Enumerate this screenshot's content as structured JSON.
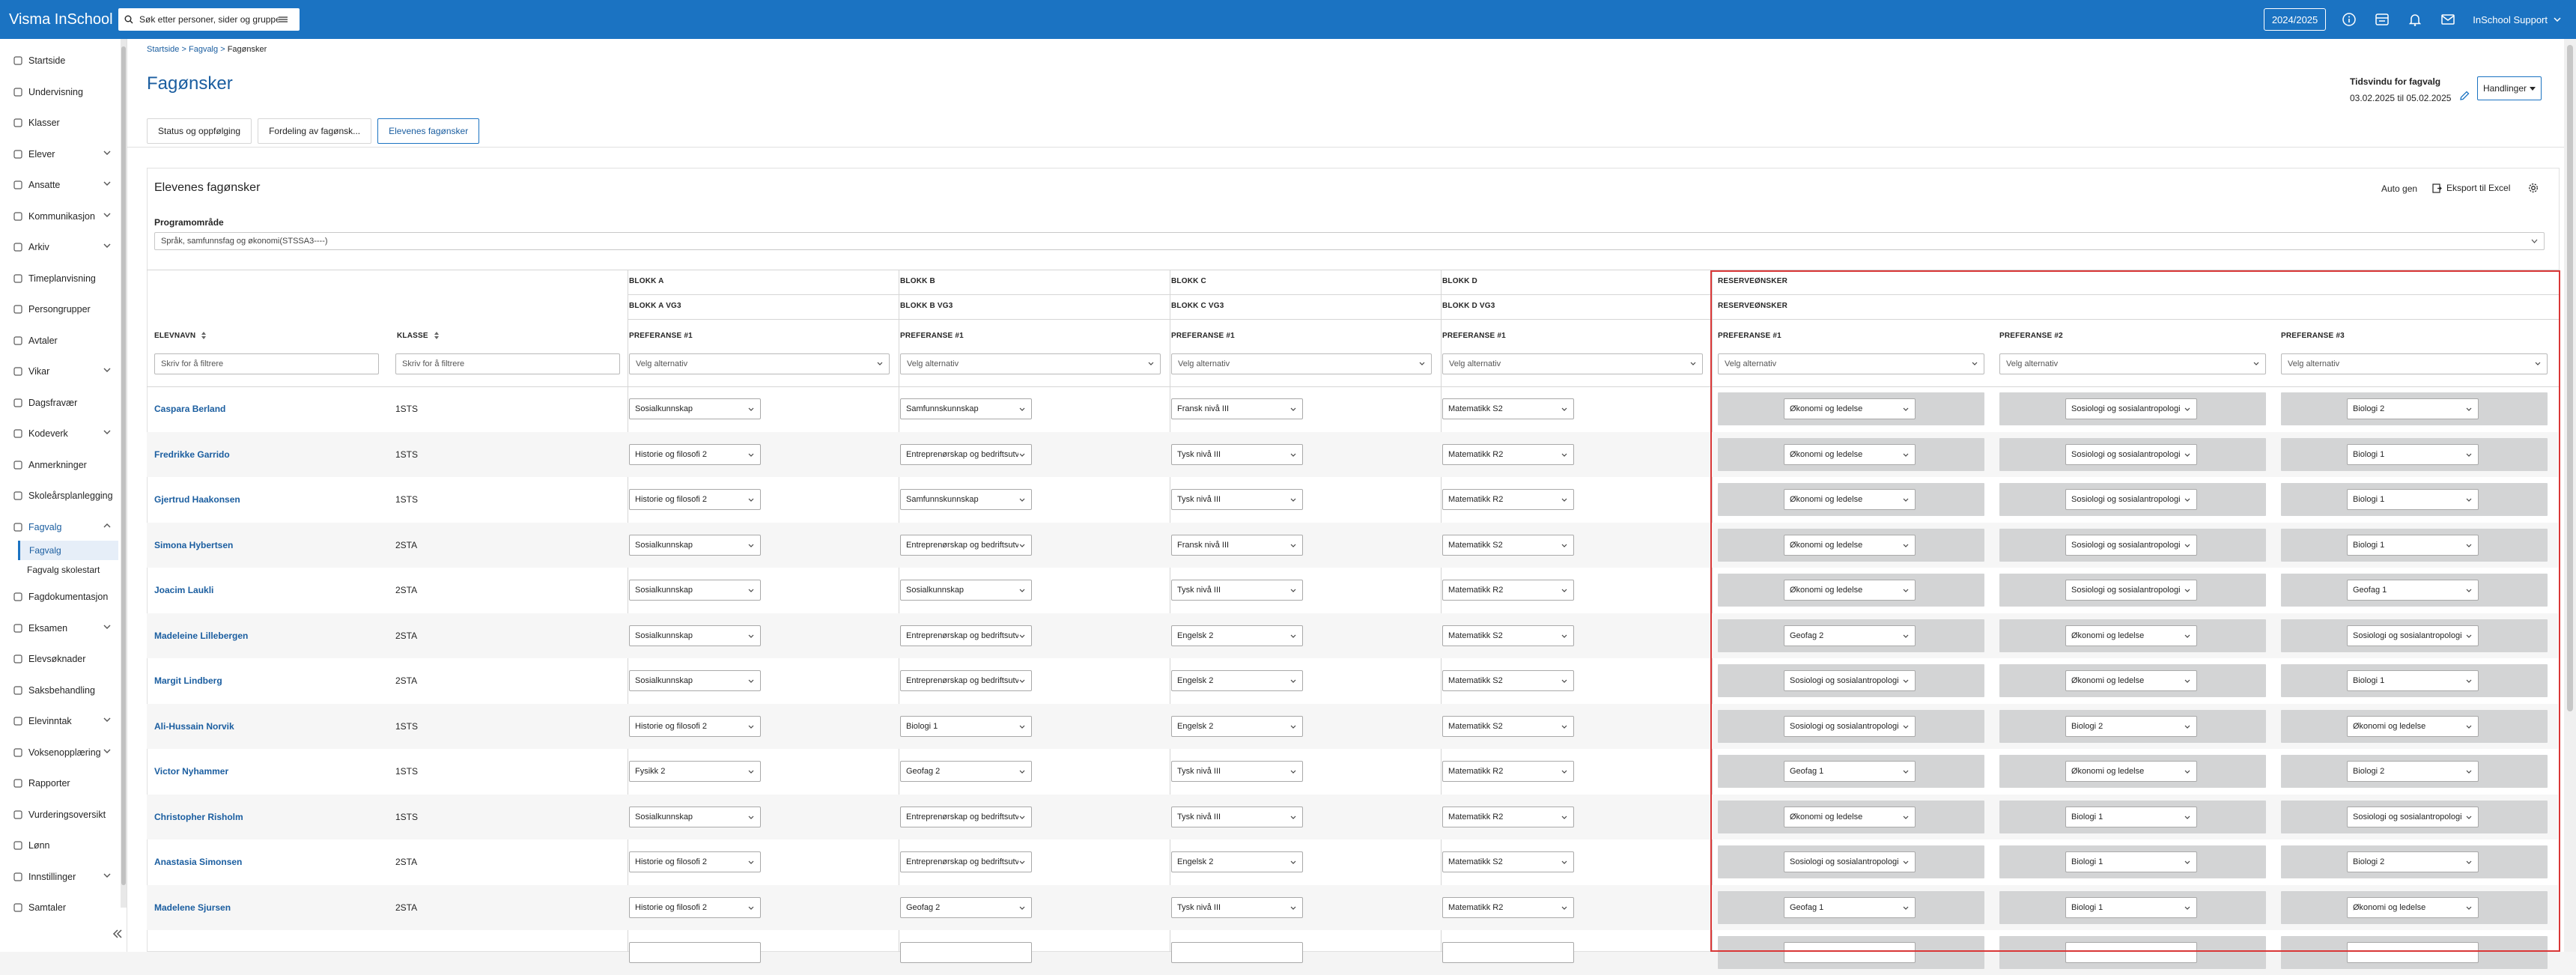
{
  "app": {
    "title": "Visma InSchool",
    "search_placeholder": "Søk etter personer, sider og grupper",
    "year": "2024/2025",
    "user": "InSchool Support"
  },
  "sidebar": {
    "items": [
      {
        "label": "Startside",
        "icon": "home-icon",
        "chevron": false
      },
      {
        "label": "Undervisning",
        "icon": "book-icon",
        "chevron": false
      },
      {
        "label": "Klasser",
        "icon": "class-icon",
        "chevron": false
      },
      {
        "label": "Elever",
        "icon": "student-icon",
        "chevron": true
      },
      {
        "label": "Ansatte",
        "icon": "staff-icon",
        "chevron": true
      },
      {
        "label": "Kommunikasjon",
        "icon": "chat-icon",
        "chevron": true
      },
      {
        "label": "Arkiv",
        "icon": "archive-icon",
        "chevron": true
      },
      {
        "label": "Timeplanvisning",
        "icon": "calendar-icon",
        "chevron": false
      },
      {
        "label": "Persongrupper",
        "icon": "group-icon",
        "chevron": false
      },
      {
        "label": "Avtaler",
        "icon": "agreement-icon",
        "chevron": false
      },
      {
        "label": "Vikar",
        "icon": "substitute-icon",
        "chevron": true
      },
      {
        "label": "Dagsfravær",
        "icon": "absence-icon",
        "chevron": false
      },
      {
        "label": "Kodeverk",
        "icon": "code-icon",
        "chevron": true
      },
      {
        "label": "Anmerkninger",
        "icon": "note-icon",
        "chevron": false
      },
      {
        "label": "Skoleårsplanlegging",
        "icon": "plan-icon",
        "chevron": false
      },
      {
        "label": "Fagvalg",
        "icon": "subject-choice-icon",
        "chevron": true,
        "expanded": true
      },
      {
        "label": "Fagdokumentasjon",
        "icon": "doc-icon",
        "chevron": false
      },
      {
        "label": "Eksamen",
        "icon": "exam-icon",
        "chevron": true
      },
      {
        "label": "Elevsøknader",
        "icon": "application-icon",
        "chevron": false
      },
      {
        "label": "Saksbehandling",
        "icon": "case-icon",
        "chevron": false
      },
      {
        "label": "Elevinntak",
        "icon": "intake-icon",
        "chevron": true
      },
      {
        "label": "Voksenopplæring",
        "icon": "adult-edu-icon",
        "chevron": true
      },
      {
        "label": "Rapporter",
        "icon": "report-icon",
        "chevron": false
      },
      {
        "label": "Vurderingsoversikt",
        "icon": "assessment-icon",
        "chevron": false
      },
      {
        "label": "Lønn",
        "icon": "salary-icon",
        "chevron": false
      },
      {
        "label": "Innstillinger",
        "icon": "settings-icon",
        "chevron": true
      },
      {
        "label": "Samtaler",
        "icon": "conversation-icon",
        "chevron": false
      }
    ],
    "sub": [
      {
        "label": "Fagvalg",
        "active": true
      },
      {
        "label": "Fagvalg skolestart",
        "active": false
      }
    ]
  },
  "breadcrumb": {
    "home": "Startside",
    "sep": ">",
    "mid": "Fagvalg",
    "current": "Fagønsker"
  },
  "page": {
    "title": "Fagønsker",
    "tw_label": "Tidsvindu for fagvalg",
    "tw_value": "03.02.2025 til 05.02.2025",
    "actions": "Handlinger"
  },
  "tabs": [
    {
      "label": "Status og oppfølging"
    },
    {
      "label": "Fordeling av fagønsk..."
    },
    {
      "label": "Elevenes fagønsker",
      "active": true
    }
  ],
  "card": {
    "title": "Elevenes fagønsker",
    "autogen": "Auto gen",
    "export": "Eksport til Excel",
    "program_label": "Programområde",
    "program_value": "Språk, samfunnsfag og økonomi(STSSA3----)"
  },
  "table": {
    "col_name": "ELEVNAVN",
    "col_class": "KLASSE",
    "filter_placeholder": "Skriv for å filtrere",
    "select_placeholder": "Velg alternativ",
    "blocks": [
      {
        "top": "BLOKK A",
        "sub": "BLOKK A VG3",
        "pref": "PREFERANSE #1"
      },
      {
        "top": "BLOKK B",
        "sub": "BLOKK B VG3",
        "pref": "PREFERANSE #1"
      },
      {
        "top": "BLOKK C",
        "sub": "BLOKK C VG3",
        "pref": "PREFERANSE #1"
      },
      {
        "top": "BLOKK D",
        "sub": "BLOKK D VG3",
        "pref": "PREFERANSE #1"
      }
    ],
    "reserve": {
      "top": "RESERVEØNSKER",
      "sub": "RESERVEØNSKER",
      "prefs": [
        "PREFERANSE #1",
        "PREFERANSE #2",
        "PREFERANSE #3"
      ]
    },
    "rows": [
      {
        "name": "Caspara Berland",
        "klasse": "1STS",
        "a": "Sosialkunnskap",
        "b": "Samfunnskunnskap",
        "c": "Fransk nivå III",
        "d": "Matematikk S2",
        "r1": "Økonomi og ledelse",
        "r2": "Sosiologi og sosialantropologi",
        "r3": "Biologi 2"
      },
      {
        "name": "Fredrikke Garrido",
        "klasse": "1STS",
        "a": "Historie og filosofi 2",
        "b": "Entreprenørskap og bedriftsutvikling",
        "c": "Tysk nivå III",
        "d": "Matematikk R2",
        "r1": "Økonomi og ledelse",
        "r2": "Sosiologi og sosialantropologi",
        "r3": "Biologi 1"
      },
      {
        "name": "Gjertrud Haakonsen",
        "klasse": "1STS",
        "a": "Historie og filosofi 2",
        "b": "Samfunnskunnskap",
        "c": "Tysk nivå III",
        "d": "Matematikk R2",
        "r1": "Økonomi og ledelse",
        "r2": "Sosiologi og sosialantropologi",
        "r3": "Biologi 1"
      },
      {
        "name": "Simona Hybertsen",
        "klasse": "2STA",
        "a": "Sosialkunnskap",
        "b": "Entreprenørskap og bedriftsutvikling",
        "c": "Fransk nivå III",
        "d": "Matematikk S2",
        "r1": "Økonomi og ledelse",
        "r2": "Sosiologi og sosialantropologi",
        "r3": "Biologi 1"
      },
      {
        "name": "Joacim Laukli",
        "klasse": "2STA",
        "a": "Sosialkunnskap",
        "b": "Sosialkunnskap",
        "c": "Tysk nivå III",
        "d": "Matematikk R2",
        "r1": "Økonomi og ledelse",
        "r2": "Sosiologi og sosialantropologi",
        "r3": "Geofag 1"
      },
      {
        "name": "Madeleine Lillebergen",
        "klasse": "2STA",
        "a": "Sosialkunnskap",
        "b": "Entreprenørskap og bedriftsutvikling",
        "c": "Engelsk 2",
        "d": "Matematikk S2",
        "r1": "Geofag 2",
        "r2": "Økonomi og ledelse",
        "r3": "Sosiologi og sosialantropologi"
      },
      {
        "name": "Margit Lindberg",
        "klasse": "2STA",
        "a": "Sosialkunnskap",
        "b": "Entreprenørskap og bedriftsutvikling",
        "c": "Engelsk 2",
        "d": "Matematikk S2",
        "r1": "Sosiologi og sosialantropologi",
        "r2": "Økonomi og ledelse",
        "r3": "Biologi 1"
      },
      {
        "name": "Ali-Hussain Norvik",
        "klasse": "1STS",
        "a": "Historie og filosofi 2",
        "b": "Biologi 1",
        "c": "Engelsk 2",
        "d": "Matematikk S2",
        "r1": "Sosiologi og sosialantropologi",
        "r2": "Biologi 2",
        "r3": "Økonomi og ledelse"
      },
      {
        "name": "Victor Nyhammer",
        "klasse": "1STS",
        "a": "Fysikk 2",
        "b": "Geofag 2",
        "c": "Tysk nivå III",
        "d": "Matematikk R2",
        "r1": "Geofag 1",
        "r2": "Økonomi og ledelse",
        "r3": "Biologi 2"
      },
      {
        "name": "Christopher Risholm",
        "klasse": "1STS",
        "a": "Sosialkunnskap",
        "b": "Entreprenørskap og bedriftsutvikling",
        "c": "Tysk nivå III",
        "d": "Matematikk R2",
        "r1": "Økonomi og ledelse",
        "r2": "Biologi 1",
        "r3": "Sosiologi og sosialantropologi"
      },
      {
        "name": "Anastasia Simonsen",
        "klasse": "2STA",
        "a": "Historie og filosofi 2",
        "b": "Entreprenørskap og bedriftsutvikling",
        "c": "Engelsk 2",
        "d": "Matematikk S2",
        "r1": "Sosiologi og sosialantropologi",
        "r2": "Biologi 1",
        "r3": "Biologi 2"
      },
      {
        "name": "Madelene Sjursen",
        "klasse": "2STA",
        "a": "Historie og filosofi 2",
        "b": "Geofag 2",
        "c": "Tysk nivå III",
        "d": "Matematikk R2",
        "r1": "Geofag 1",
        "r2": "Biologi 1",
        "r3": "Økonomi og ledelse"
      }
    ]
  },
  "colors": {
    "topbar": "#1b73c2",
    "link": "#1b5ea0",
    "highlight_border": "#d93737",
    "reserve_cell": "#d3d4d5"
  }
}
